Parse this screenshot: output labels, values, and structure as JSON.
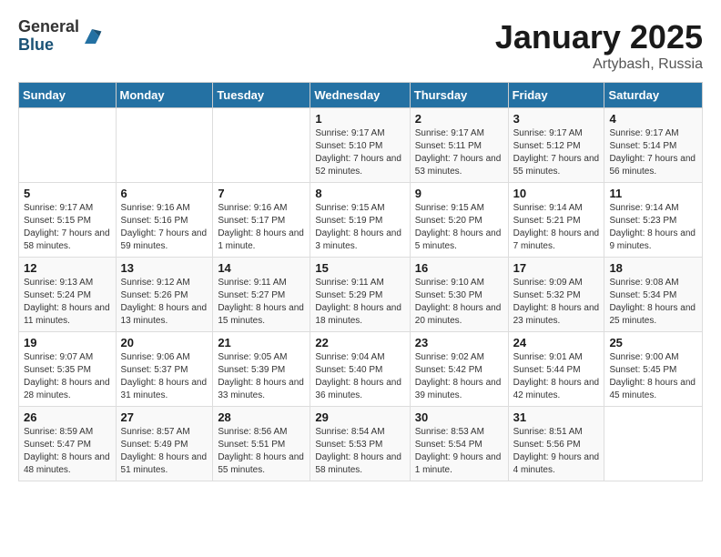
{
  "header": {
    "logo_general": "General",
    "logo_blue": "Blue",
    "title": "January 2025",
    "subtitle": "Artybash, Russia"
  },
  "days_of_week": [
    "Sunday",
    "Monday",
    "Tuesday",
    "Wednesday",
    "Thursday",
    "Friday",
    "Saturday"
  ],
  "weeks": [
    [
      {
        "day": "",
        "info": ""
      },
      {
        "day": "",
        "info": ""
      },
      {
        "day": "",
        "info": ""
      },
      {
        "day": "1",
        "info": "Sunrise: 9:17 AM\nSunset: 5:10 PM\nDaylight: 7 hours and 52 minutes."
      },
      {
        "day": "2",
        "info": "Sunrise: 9:17 AM\nSunset: 5:11 PM\nDaylight: 7 hours and 53 minutes."
      },
      {
        "day": "3",
        "info": "Sunrise: 9:17 AM\nSunset: 5:12 PM\nDaylight: 7 hours and 55 minutes."
      },
      {
        "day": "4",
        "info": "Sunrise: 9:17 AM\nSunset: 5:14 PM\nDaylight: 7 hours and 56 minutes."
      }
    ],
    [
      {
        "day": "5",
        "info": "Sunrise: 9:17 AM\nSunset: 5:15 PM\nDaylight: 7 hours and 58 minutes."
      },
      {
        "day": "6",
        "info": "Sunrise: 9:16 AM\nSunset: 5:16 PM\nDaylight: 7 hours and 59 minutes."
      },
      {
        "day": "7",
        "info": "Sunrise: 9:16 AM\nSunset: 5:17 PM\nDaylight: 8 hours and 1 minute."
      },
      {
        "day": "8",
        "info": "Sunrise: 9:15 AM\nSunset: 5:19 PM\nDaylight: 8 hours and 3 minutes."
      },
      {
        "day": "9",
        "info": "Sunrise: 9:15 AM\nSunset: 5:20 PM\nDaylight: 8 hours and 5 minutes."
      },
      {
        "day": "10",
        "info": "Sunrise: 9:14 AM\nSunset: 5:21 PM\nDaylight: 8 hours and 7 minutes."
      },
      {
        "day": "11",
        "info": "Sunrise: 9:14 AM\nSunset: 5:23 PM\nDaylight: 8 hours and 9 minutes."
      }
    ],
    [
      {
        "day": "12",
        "info": "Sunrise: 9:13 AM\nSunset: 5:24 PM\nDaylight: 8 hours and 11 minutes."
      },
      {
        "day": "13",
        "info": "Sunrise: 9:12 AM\nSunset: 5:26 PM\nDaylight: 8 hours and 13 minutes."
      },
      {
        "day": "14",
        "info": "Sunrise: 9:11 AM\nSunset: 5:27 PM\nDaylight: 8 hours and 15 minutes."
      },
      {
        "day": "15",
        "info": "Sunrise: 9:11 AM\nSunset: 5:29 PM\nDaylight: 8 hours and 18 minutes."
      },
      {
        "day": "16",
        "info": "Sunrise: 9:10 AM\nSunset: 5:30 PM\nDaylight: 8 hours and 20 minutes."
      },
      {
        "day": "17",
        "info": "Sunrise: 9:09 AM\nSunset: 5:32 PM\nDaylight: 8 hours and 23 minutes."
      },
      {
        "day": "18",
        "info": "Sunrise: 9:08 AM\nSunset: 5:34 PM\nDaylight: 8 hours and 25 minutes."
      }
    ],
    [
      {
        "day": "19",
        "info": "Sunrise: 9:07 AM\nSunset: 5:35 PM\nDaylight: 8 hours and 28 minutes."
      },
      {
        "day": "20",
        "info": "Sunrise: 9:06 AM\nSunset: 5:37 PM\nDaylight: 8 hours and 31 minutes."
      },
      {
        "day": "21",
        "info": "Sunrise: 9:05 AM\nSunset: 5:39 PM\nDaylight: 8 hours and 33 minutes."
      },
      {
        "day": "22",
        "info": "Sunrise: 9:04 AM\nSunset: 5:40 PM\nDaylight: 8 hours and 36 minutes."
      },
      {
        "day": "23",
        "info": "Sunrise: 9:02 AM\nSunset: 5:42 PM\nDaylight: 8 hours and 39 minutes."
      },
      {
        "day": "24",
        "info": "Sunrise: 9:01 AM\nSunset: 5:44 PM\nDaylight: 8 hours and 42 minutes."
      },
      {
        "day": "25",
        "info": "Sunrise: 9:00 AM\nSunset: 5:45 PM\nDaylight: 8 hours and 45 minutes."
      }
    ],
    [
      {
        "day": "26",
        "info": "Sunrise: 8:59 AM\nSunset: 5:47 PM\nDaylight: 8 hours and 48 minutes."
      },
      {
        "day": "27",
        "info": "Sunrise: 8:57 AM\nSunset: 5:49 PM\nDaylight: 8 hours and 51 minutes."
      },
      {
        "day": "28",
        "info": "Sunrise: 8:56 AM\nSunset: 5:51 PM\nDaylight: 8 hours and 55 minutes."
      },
      {
        "day": "29",
        "info": "Sunrise: 8:54 AM\nSunset: 5:53 PM\nDaylight: 8 hours and 58 minutes."
      },
      {
        "day": "30",
        "info": "Sunrise: 8:53 AM\nSunset: 5:54 PM\nDaylight: 9 hours and 1 minute."
      },
      {
        "day": "31",
        "info": "Sunrise: 8:51 AM\nSunset: 5:56 PM\nDaylight: 9 hours and 4 minutes."
      },
      {
        "day": "",
        "info": ""
      }
    ]
  ]
}
